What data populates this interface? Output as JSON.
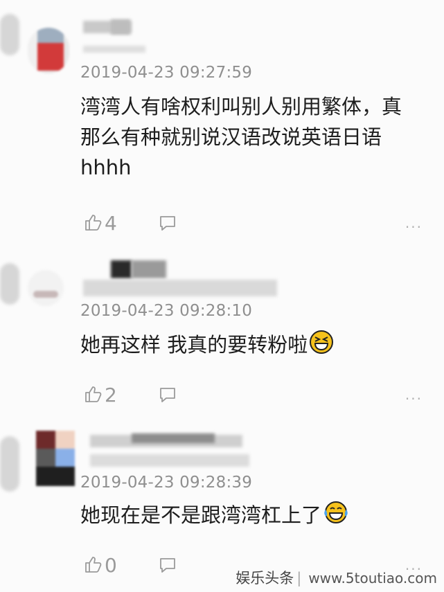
{
  "comments": [
    {
      "timestamp": "2019-04-23 09:27:59",
      "text": "湾湾人有啥权利叫别人别用繁体，真那么有种就别说汉语改说英语日语hhhh",
      "likes": "4",
      "emoji": ""
    },
    {
      "timestamp": "2019-04-23 09:28:10",
      "text": "她再这样 我真的要转粉啦",
      "likes": "2",
      "emoji": "grinning-squinting-face"
    },
    {
      "timestamp": "2019-04-23 09:28:39",
      "text": "她现在是不是跟湾湾杠上了",
      "likes": "0",
      "emoji": "face-with-tears-of-joy"
    }
  ],
  "icons": {
    "like": "thumbs-up-icon",
    "reply": "comment-bubble-icon",
    "more": "more-dots-icon"
  },
  "more_glyph": "···",
  "watermark": {
    "brand": "娱乐头条",
    "site": "www.5toutiao.com"
  },
  "colors": {
    "background": "#fbfbfb",
    "text": "#1d1d1d",
    "meta": "#8f8f8f",
    "icon": "#9a9a9a"
  }
}
